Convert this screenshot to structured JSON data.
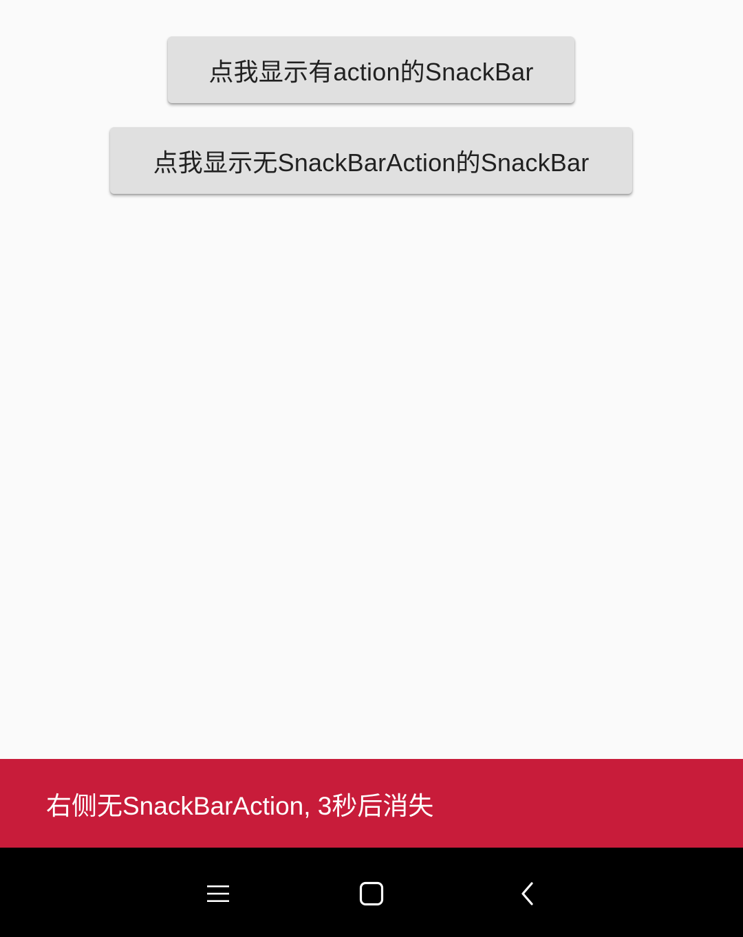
{
  "buttons": {
    "with_action_label": "点我显示有action的SnackBar",
    "without_action_label": "点我显示无SnackBarAction的SnackBar"
  },
  "snackbar": {
    "message": "右侧无SnackBarAction, 3秒后消失",
    "background_color": "#c81c3a",
    "text_color": "#ffffff"
  },
  "navbar": {
    "items": [
      {
        "icon": "menu-icon"
      },
      {
        "icon": "home-square-icon"
      },
      {
        "icon": "back-chevron-icon"
      }
    ]
  }
}
